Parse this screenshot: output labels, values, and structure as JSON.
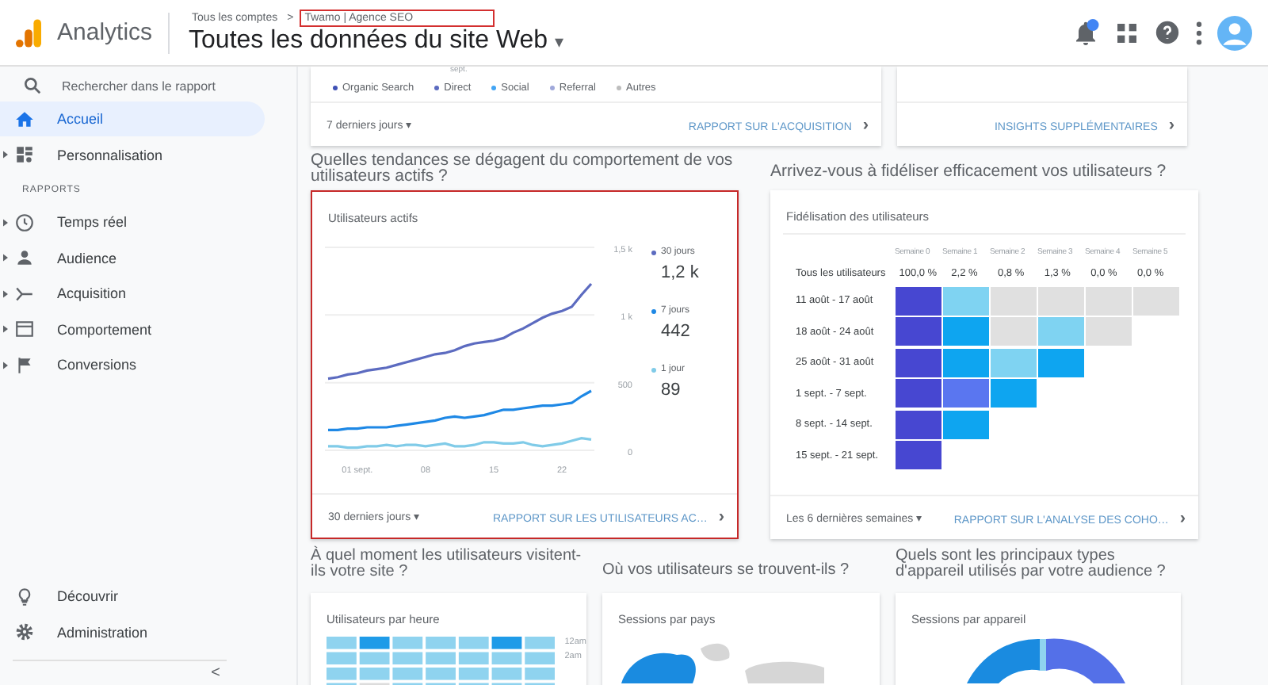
{
  "header": {
    "app_name": "Analytics",
    "breadcrumb_root": "Tous les comptes",
    "breadcrumb_separator": ">",
    "account": {
      "label": "Twamo | Agence SEO",
      "highlighted": true
    },
    "view_title": "Toutes les données du site Web",
    "view_caret": "▾"
  },
  "sidebar": {
    "search": {
      "placeholder": "Rechercher dans le rapport"
    },
    "top_items": [
      {
        "label": "Accueil",
        "selected": true,
        "expandable": false
      },
      {
        "label": "Personnalisation",
        "selected": false,
        "expandable": true
      }
    ],
    "section_label": "RAPPORTS",
    "report_items": [
      {
        "label": "Temps réel",
        "selected": false,
        "expandable": true
      },
      {
        "label": "Audience",
        "selected": false,
        "expandable": true
      },
      {
        "label": "Acquisition",
        "selected": false,
        "expandable": true
      },
      {
        "label": "Comportement",
        "selected": false,
        "expandable": true
      },
      {
        "label": "Conversions",
        "selected": false,
        "expandable": true
      }
    ],
    "bottom_items": [
      {
        "label": "Découvrir"
      },
      {
        "label": "Administration"
      }
    ],
    "collapse": "<"
  },
  "acquisition_card": {
    "axis_label": "sept.",
    "legend": [
      {
        "label": "Organic Search",
        "color": "#3f51b5"
      },
      {
        "label": "Direct",
        "color": "#5c6bc0"
      },
      {
        "label": "Social",
        "color": "#42a5f5"
      },
      {
        "label": "Referral",
        "color": "#9fa8da"
      },
      {
        "label": "Autres",
        "color": "#bdbdbd"
      }
    ],
    "range": "7 derniers jours",
    "range_caret": "▾",
    "link": "RAPPORT SUR L'ACQUISITION",
    "link_arrow": "›"
  },
  "insights_card": {
    "link": "INSIGHTS SUPPLÉMENTAIRES",
    "link_arrow": "›"
  },
  "headings": [
    "Quelles tendances se dégagent du comportement de vos utilisateurs actifs ?",
    "Arrivez-vous à fidéliser efficacement vos utilisateurs ?"
  ],
  "active_users": {
    "title": "Utilisateurs actifs",
    "highlighted": true,
    "chart_data": {
      "type": "line",
      "categories": [
        null,
        null,
        null,
        "01 sept.",
        null,
        null,
        null,
        null,
        null,
        null,
        "08",
        null,
        null,
        null,
        null,
        null,
        null,
        "15",
        null,
        null,
        null,
        null,
        null,
        null,
        "22",
        null,
        null,
        null
      ],
      "ylim": [
        0,
        1500
      ],
      "yticks": [
        {
          "value": 0,
          "label": "0"
        },
        {
          "value": 500,
          "label": "500"
        },
        {
          "value": 1000,
          "label": "1 k"
        },
        {
          "value": 1500,
          "label": "1,5 k"
        }
      ],
      "series": [
        {
          "name": "30 jours",
          "color": "#5c6bc0",
          "values": [
            530,
            540,
            560,
            570,
            590,
            600,
            610,
            630,
            650,
            670,
            690,
            710,
            720,
            740,
            770,
            790,
            800,
            810,
            830,
            870,
            900,
            940,
            980,
            1010,
            1030,
            1060,
            1150,
            1230
          ]
        },
        {
          "name": "7 jours",
          "color": "#1e88e5",
          "values": [
            150,
            150,
            160,
            160,
            170,
            170,
            170,
            180,
            190,
            200,
            210,
            220,
            240,
            250,
            240,
            250,
            260,
            280,
            300,
            300,
            310,
            320,
            330,
            330,
            340,
            350,
            400,
            440
          ]
        },
        {
          "name": "1 jour",
          "color": "#80cbe8",
          "values": [
            30,
            30,
            20,
            20,
            30,
            30,
            40,
            30,
            40,
            40,
            30,
            40,
            50,
            30,
            30,
            40,
            60,
            60,
            50,
            50,
            60,
            40,
            30,
            40,
            50,
            70,
            90,
            80
          ]
        }
      ]
    },
    "totals": [
      "1,2 k",
      "442",
      "89"
    ],
    "range": "30 derniers jours",
    "range_caret": "▾",
    "link": "RAPPORT SUR LES UTILISATEURS AC…",
    "link_arrow": "›"
  },
  "retention": {
    "title": "Fidélisation des utilisateurs",
    "weeks": [
      "Semaine 0",
      "Semaine 1",
      "Semaine 2",
      "Semaine 3",
      "Semaine 4",
      "Semaine 5"
    ],
    "all_users": {
      "label": "Tous les utilisateurs",
      "values": [
        "100,0 %",
        "2,2 %",
        "0,8 %",
        "1,3 %",
        "0,0 %",
        "0,0 %"
      ]
    },
    "rows": [
      {
        "label": "11 août - 17 août",
        "cells": [
          {
            "color": "#4747d1"
          },
          {
            "color": "#7fd3f2"
          },
          {
            "color": "#e0e0e0"
          },
          {
            "color": "#e0e0e0"
          },
          {
            "color": "#e0e0e0"
          },
          {
            "color": "#e0e0e0"
          }
        ]
      },
      {
        "label": "18 août - 24 août",
        "cells": [
          {
            "color": "#4747d1"
          },
          {
            "color": "#0ea5f0"
          },
          {
            "color": "#e0e0e0"
          },
          {
            "color": "#7fd3f2"
          },
          {
            "color": "#e0e0e0"
          }
        ]
      },
      {
        "label": "25 août - 31 août",
        "cells": [
          {
            "color": "#4747d1"
          },
          {
            "color": "#0ea5f0"
          },
          {
            "color": "#7fd3f2"
          },
          {
            "color": "#0ea5f0"
          }
        ]
      },
      {
        "label": "1 sept. - 7 sept.",
        "cells": [
          {
            "color": "#4747d1"
          },
          {
            "color": "#5a76f0"
          },
          {
            "color": "#0ea5f0"
          }
        ]
      },
      {
        "label": "8 sept. - 14 sept.",
        "cells": [
          {
            "color": "#4747d1"
          },
          {
            "color": "#0ea5f0"
          }
        ]
      },
      {
        "label": "15 sept. - 21 sept.",
        "cells": [
          {
            "color": "#4747d1"
          }
        ]
      }
    ],
    "range": "Les 6 dernières semaines",
    "range_caret": "▾",
    "link": "RAPPORT SUR L'ANALYSE DES COHO…",
    "link_arrow": "›"
  },
  "bottom": [
    {
      "kind": "heatmap",
      "heading": "À quel moment les utilisateurs visitent-ils votre site ?",
      "title": "Utilisateurs par heure",
      "row_labels": [
        "12am",
        "2am"
      ]
    },
    {
      "kind": "map",
      "heading": "Où vos utilisateurs se trouvent-ils ?",
      "title": "Sessions par pays"
    },
    {
      "kind": "donut",
      "heading": "Quels sont les principaux types d'appareil utilisés par votre audience ?",
      "title": "Sessions par appareil"
    }
  ]
}
